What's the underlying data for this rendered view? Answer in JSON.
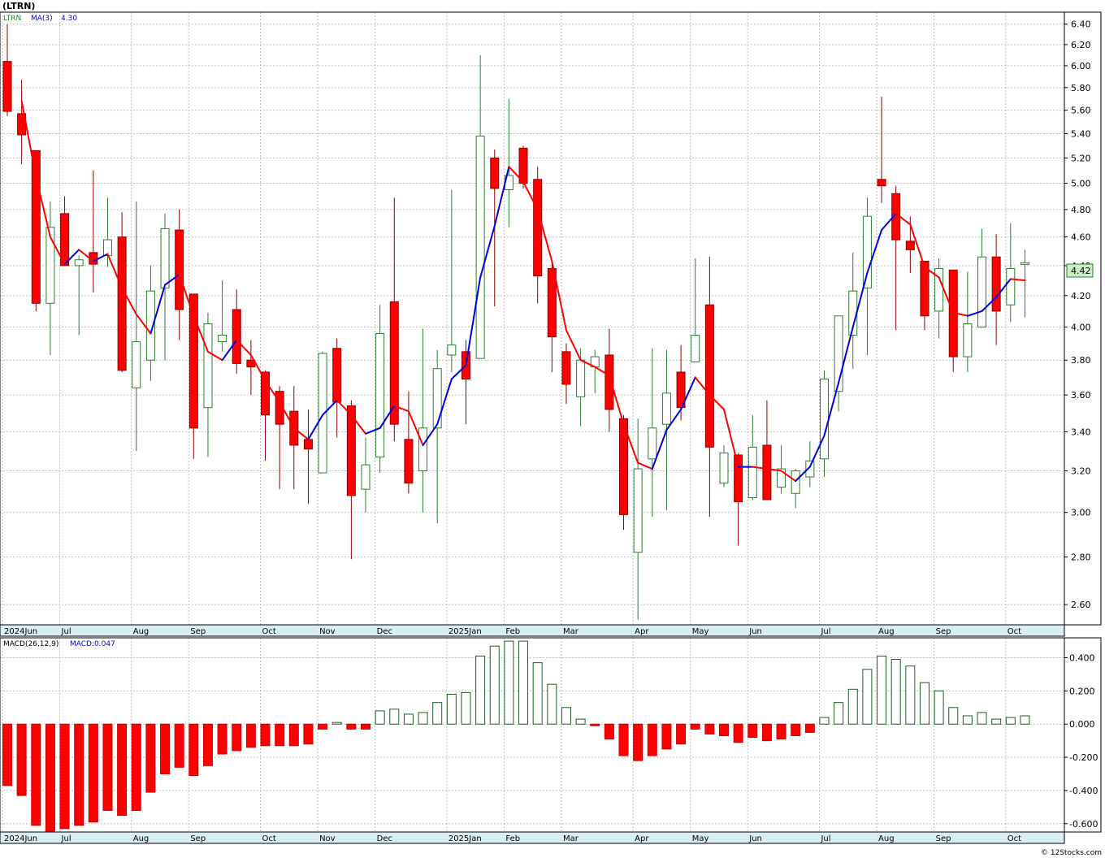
{
  "header": {
    "title": "(LTRN)"
  },
  "price_panel": {
    "legend_symbol": "LTRN",
    "legend_ma": "MA(3)",
    "legend_ma_value": "4.30",
    "last_price_label": "4.42"
  },
  "macd_panel": {
    "legend_macd": "MACD(26,12,9)",
    "legend_value": "MACD:0.047"
  },
  "footer": {
    "credit": "© 12Stocks.com"
  },
  "colors": {
    "up": "#ffffff",
    "up_border": "#2e7d32",
    "down": "#ff0000",
    "down_border": "#8b0000",
    "ma_up": "#0000dd",
    "ma_down": "#ff0000",
    "axis_bg": "#d8eef4",
    "grid": "#c0c0c0",
    "last_price_bg": "#c8f0c0"
  },
  "chart_data": [
    {
      "type": "candlestick",
      "title": "(LTRN)",
      "interval": "weekly",
      "y_scale": "log",
      "ylim": [
        2.52,
        6.52
      ],
      "y_ticks": [
        2.6,
        2.8,
        3.0,
        3.2,
        3.4,
        3.6,
        3.8,
        4.0,
        4.2,
        4.4,
        4.6,
        4.8,
        5.0,
        5.2,
        5.4,
        5.6,
        5.8,
        6.0,
        6.2,
        6.4
      ],
      "y_tick_labels": [
        "2.60",
        "2.80",
        "3.00",
        "3.20",
        "3.40",
        "3.60",
        "3.80",
        "4.00",
        "4.20",
        "4.40",
        "4.60",
        "4.80",
        "5.00",
        "5.20",
        "5.40",
        "5.60",
        "5.80",
        "6.00",
        "6.20",
        "6.40"
      ],
      "x_labels": [
        {
          "label": "2024Jun",
          "index": 0
        },
        {
          "label": "Jul",
          "index": 4
        },
        {
          "label": "Aug",
          "index": 9
        },
        {
          "label": "Sep",
          "index": 13
        },
        {
          "label": "Oct",
          "index": 18
        },
        {
          "label": "Nov",
          "index": 22
        },
        {
          "label": "Dec",
          "index": 26
        },
        {
          "label": "2025Jan",
          "index": 31
        },
        {
          "label": "Feb",
          "index": 35
        },
        {
          "label": "Mar",
          "index": 39
        },
        {
          "label": "Apr",
          "index": 44
        },
        {
          "label": "May",
          "index": 48
        },
        {
          "label": "Jun",
          "index": 52
        },
        {
          "label": "Jul",
          "index": 57
        },
        {
          "label": "Aug",
          "index": 61
        },
        {
          "label": "Sep",
          "index": 65
        },
        {
          "label": "Oct",
          "index": 70
        }
      ],
      "ohlc": [
        [
          6.04,
          6.4,
          5.55,
          5.59
        ],
        [
          5.57,
          5.87,
          5.15,
          5.39
        ],
        [
          5.26,
          5.26,
          4.1,
          4.15
        ],
        [
          4.15,
          4.86,
          3.83,
          4.67
        ],
        [
          4.77,
          4.9,
          4.4,
          4.4
        ],
        [
          4.4,
          4.47,
          3.95,
          4.44
        ],
        [
          4.49,
          5.1,
          4.22,
          4.41
        ],
        [
          4.47,
          4.89,
          4.39,
          4.58
        ],
        [
          4.6,
          4.78,
          3.73,
          3.74
        ],
        [
          3.64,
          4.86,
          3.3,
          3.91
        ],
        [
          3.8,
          4.4,
          3.68,
          4.23
        ],
        [
          4.25,
          4.77,
          3.8,
          4.66
        ],
        [
          4.65,
          4.8,
          3.92,
          4.11
        ],
        [
          4.21,
          4.21,
          3.26,
          3.42
        ],
        [
          3.53,
          4.09,
          3.27,
          4.02
        ],
        [
          3.91,
          4.3,
          3.85,
          3.95
        ],
        [
          4.11,
          4.24,
          3.72,
          3.78
        ],
        [
          3.8,
          3.92,
          3.6,
          3.76
        ],
        [
          3.73,
          3.74,
          3.25,
          3.49
        ],
        [
          3.62,
          3.65,
          3.11,
          3.44
        ],
        [
          3.51,
          3.65,
          3.11,
          3.33
        ],
        [
          3.36,
          3.52,
          3.04,
          3.31
        ],
        [
          3.19,
          3.85,
          3.19,
          3.84
        ],
        [
          3.87,
          3.93,
          3.37,
          3.56
        ],
        [
          3.54,
          3.57,
          2.79,
          3.08
        ],
        [
          3.11,
          3.37,
          3.0,
          3.23
        ],
        [
          3.27,
          4.14,
          3.19,
          3.96
        ],
        [
          4.16,
          4.89,
          3.35,
          3.44
        ],
        [
          3.36,
          3.62,
          3.09,
          3.14
        ],
        [
          3.2,
          3.99,
          3.0,
          3.42
        ],
        [
          3.42,
          3.86,
          2.95,
          3.75
        ],
        [
          3.83,
          4.95,
          3.73,
          3.89
        ],
        [
          3.85,
          3.92,
          3.44,
          3.69
        ],
        [
          3.81,
          6.1,
          3.81,
          5.38
        ],
        [
          5.2,
          5.27,
          4.13,
          4.96
        ],
        [
          4.95,
          5.7,
          4.67,
          5.06
        ],
        [
          5.28,
          5.3,
          4.96,
          5.0
        ],
        [
          5.03,
          5.13,
          4.15,
          4.33
        ],
        [
          4.38,
          4.43,
          3.73,
          3.94
        ],
        [
          3.85,
          3.9,
          3.55,
          3.66
        ],
        [
          3.59,
          3.87,
          3.43,
          3.8
        ],
        [
          3.76,
          3.86,
          3.61,
          3.82
        ],
        [
          3.83,
          3.99,
          3.4,
          3.52
        ],
        [
          3.47,
          3.49,
          2.92,
          2.99
        ],
        [
          2.82,
          3.47,
          2.54,
          3.21
        ],
        [
          3.26,
          3.87,
          2.98,
          3.42
        ],
        [
          3.44,
          3.86,
          3.01,
          3.61
        ],
        [
          3.73,
          3.89,
          3.46,
          3.53
        ],
        [
          3.79,
          4.45,
          3.79,
          3.95
        ],
        [
          4.14,
          4.46,
          2.98,
          3.32
        ],
        [
          3.14,
          3.33,
          3.12,
          3.29
        ],
        [
          3.28,
          3.29,
          2.85,
          3.05
        ],
        [
          3.07,
          3.49,
          3.06,
          3.32
        ],
        [
          3.33,
          3.57,
          3.06,
          3.06
        ],
        [
          3.12,
          3.33,
          3.09,
          3.21
        ],
        [
          3.09,
          3.21,
          3.02,
          3.2
        ],
        [
          3.17,
          3.35,
          3.12,
          3.25
        ],
        [
          3.26,
          3.74,
          3.17,
          3.69
        ],
        [
          3.62,
          4.07,
          3.51,
          4.07
        ],
        [
          3.95,
          4.49,
          3.75,
          4.23
        ],
        [
          4.25,
          4.89,
          3.83,
          4.75
        ],
        [
          5.03,
          5.72,
          4.85,
          4.98
        ],
        [
          4.92,
          4.98,
          3.98,
          4.58
        ],
        [
          4.57,
          4.75,
          4.35,
          4.51
        ],
        [
          4.43,
          4.43,
          3.98,
          4.07
        ],
        [
          4.1,
          4.45,
          3.93,
          4.38
        ],
        [
          4.37,
          4.37,
          3.73,
          3.82
        ],
        [
          3.82,
          4.36,
          3.73,
          4.02
        ],
        [
          4.0,
          4.66,
          4.0,
          4.46
        ],
        [
          4.46,
          4.62,
          3.89,
          4.1
        ],
        [
          4.14,
          4.7,
          4.03,
          4.38
        ],
        [
          4.42,
          4.51,
          4.06,
          4.42
        ]
      ],
      "series": [
        {
          "name": "MA(3)",
          "values": [
            null,
            5.68,
            5.05,
            4.6,
            4.41,
            4.51,
            4.43,
            4.48,
            4.25,
            4.08,
            3.96,
            4.27,
            4.34,
            4.07,
            3.85,
            3.8,
            3.92,
            3.83,
            3.68,
            3.56,
            3.42,
            3.36,
            3.49,
            3.57,
            3.49,
            3.39,
            3.42,
            3.54,
            3.51,
            3.33,
            3.44,
            3.69,
            3.77,
            4.32,
            4.68,
            5.13,
            5.01,
            4.8,
            4.43,
            3.98,
            3.8,
            3.76,
            3.71,
            3.44,
            3.24,
            3.21,
            3.41,
            3.52,
            3.7,
            3.6,
            3.52,
            3.22,
            3.22,
            3.21,
            3.2,
            3.15,
            3.22,
            3.38,
            3.67,
            4.0,
            4.35,
            4.65,
            4.77,
            4.69,
            4.39,
            4.32,
            4.09,
            4.07,
            4.1,
            4.19,
            4.31,
            4.3
          ]
        }
      ]
    },
    {
      "type": "bar",
      "title": "MACD(26,12,9)",
      "ylim": [
        -0.65,
        0.52
      ],
      "y_ticks": [
        -0.6,
        -0.4,
        -0.2,
        0.0,
        0.2,
        0.4
      ],
      "y_tick_labels": [
        "-0.600",
        "-0.400",
        "-0.200",
        "0.000",
        "0.200",
        "0.400"
      ],
      "values": [
        -0.37,
        -0.43,
        -0.61,
        -0.65,
        -0.63,
        -0.61,
        -0.59,
        -0.52,
        -0.55,
        -0.52,
        -0.41,
        -0.3,
        -0.26,
        -0.31,
        -0.25,
        -0.18,
        -0.16,
        -0.14,
        -0.13,
        -0.13,
        -0.13,
        -0.12,
        -0.03,
        0.01,
        -0.03,
        -0.03,
        0.08,
        0.09,
        0.06,
        0.07,
        0.13,
        0.18,
        0.19,
        0.41,
        0.47,
        0.5,
        0.5,
        0.37,
        0.24,
        0.1,
        0.03,
        -0.01,
        -0.09,
        -0.19,
        -0.22,
        -0.19,
        -0.15,
        -0.12,
        -0.03,
        -0.06,
        -0.07,
        -0.11,
        -0.08,
        -0.1,
        -0.09,
        -0.07,
        -0.05,
        0.04,
        0.13,
        0.21,
        0.33,
        0.41,
        0.39,
        0.35,
        0.25,
        0.2,
        0.1,
        0.05,
        0.07,
        0.03,
        0.04,
        0.05
      ]
    }
  ]
}
